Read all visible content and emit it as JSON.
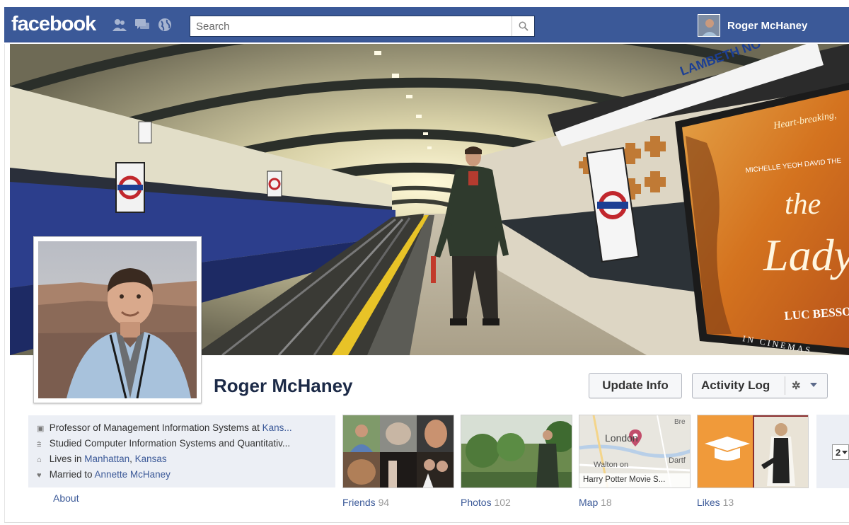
{
  "topbar": {
    "logo": "facebook",
    "search_placeholder": "Search",
    "user_name": "Roger McHaney"
  },
  "profile": {
    "name": "Roger McHaney",
    "update_info_label": "Update Info",
    "activity_log_label": "Activity Log"
  },
  "cover": {
    "station_sign": "LAMBETH NO",
    "poster_title_the": "the",
    "poster_title_lady": "Lady",
    "poster_director": "LUC BESSON",
    "poster_release": "IN CINEMAS",
    "poster_tagline": "Heart-breaking,",
    "poster_cast": "MICHELLE YEOH   DAVID THE"
  },
  "info": {
    "work_prefix": "Professor of Management Information Systems at ",
    "work_link": "Kans...",
    "study": "Studied Computer Information Systems and Quantitativ...",
    "lives_prefix": "Lives in ",
    "lives_city": "Manhattan",
    "lives_sep": ", ",
    "lives_state": "Kansas",
    "married_prefix": "Married to ",
    "married_link": "Annette McHaney",
    "about_label": "About"
  },
  "tiles": {
    "friends_label": "Friends",
    "friends_count": "94",
    "photos_label": "Photos",
    "photos_count": "102",
    "map_label": "Map",
    "map_count": "18",
    "map_city": "London",
    "map_place1": "Walton on",
    "map_place2": "Dartf",
    "map_place3": "Bre",
    "map_caption": "Harry Potter Movie S...",
    "likes_label": "Likes",
    "likes_count": "13",
    "more_count": "2"
  },
  "colors": {
    "brand_blue": "#3b5998",
    "link_blue": "#3b5998",
    "info_bg": "#eceff5"
  },
  "icons": {
    "friends": "friends-icon",
    "messages": "messages-icon",
    "notifications": "globe-icon",
    "search": "magnifier-icon",
    "work": "briefcase-icon",
    "study": "graduation-cap-icon",
    "home": "house-icon",
    "heart": "heart-icon",
    "settings": "gear-icon"
  }
}
